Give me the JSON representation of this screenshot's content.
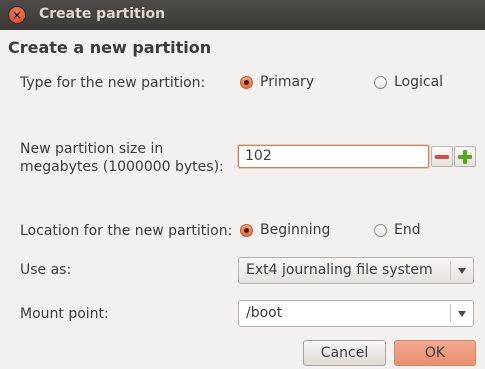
{
  "window": {
    "title": "Create partition",
    "close_glyph": "×"
  },
  "dialog": {
    "heading": "Create a new partition"
  },
  "type": {
    "label": "Type for the new partition:",
    "options": [
      {
        "label": "Primary",
        "selected": true
      },
      {
        "label": "Logical",
        "selected": false
      }
    ]
  },
  "size": {
    "label_line1": "New partition size in",
    "label_line2": "megabytes (1000000 bytes):",
    "value": "102",
    "decrement_icon": "minus-icon",
    "increment_icon": "plus-icon"
  },
  "location": {
    "label": "Location for the new partition:",
    "options": [
      {
        "label": "Beginning",
        "selected": true
      },
      {
        "label": "End",
        "selected": false
      }
    ]
  },
  "use_as": {
    "label": "Use as:",
    "value": "Ext4 journaling file system"
  },
  "mount_point": {
    "label": "Mount point:",
    "value": "/boot"
  },
  "buttons": {
    "cancel": "Cancel",
    "ok": "OK"
  },
  "colors": {
    "accent": "#e56d3d",
    "titlebar": "#3b3a36",
    "ok_button": "#ef9c7e",
    "minus": "#d94b4b",
    "plus": "#5aa51c"
  }
}
